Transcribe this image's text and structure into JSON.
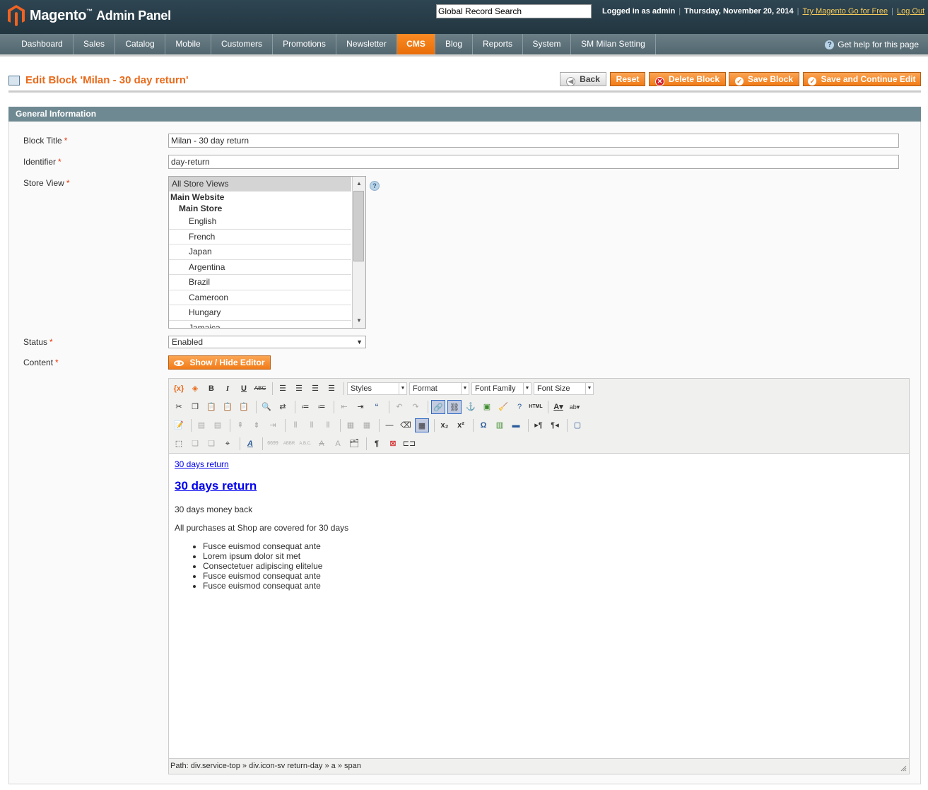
{
  "header": {
    "logo_brand": "Magento",
    "logo_sub": "Admin Panel",
    "search_placeholder": "Global Record Search",
    "logged_in": "Logged in as admin",
    "date": "Thursday, November 20, 2014",
    "try_link": "Try Magento Go for Free",
    "logout": "Log Out"
  },
  "nav": {
    "items": [
      "Dashboard",
      "Sales",
      "Catalog",
      "Mobile",
      "Customers",
      "Promotions",
      "Newsletter",
      "CMS",
      "Blog",
      "Reports",
      "System",
      "SM Milan Setting"
    ],
    "active": "CMS",
    "help": "Get help for this page"
  },
  "page": {
    "title": "Edit Block 'Milan - 30 day return'",
    "buttons": {
      "back": "Back",
      "reset": "Reset",
      "delete": "Delete Block",
      "save": "Save Block",
      "save_continue": "Save and Continue Edit"
    }
  },
  "form": {
    "section": "General Information",
    "block_title_label": "Block Title",
    "block_title_value": "Milan - 30 day return",
    "identifier_label": "Identifier",
    "identifier_value": "day-return",
    "store_view_label": "Store View",
    "store_view_selected": "All Store Views",
    "store_view_group": "Main Website",
    "store_view_subgroup": "Main Store",
    "store_views": [
      "English",
      "French",
      "Japan",
      "Argentina",
      "Brazil",
      "Cameroon",
      "Hungary",
      "Jamaica"
    ],
    "status_label": "Status",
    "status_value": "Enabled",
    "content_label": "Content",
    "toggle_editor": "Show / Hide Editor",
    "required_mark": "*"
  },
  "editor": {
    "styles": "Styles",
    "format": "Format",
    "font_family": "Font Family",
    "font_size": "Font Size",
    "content": {
      "link": "30 days return",
      "heading": "30 days return",
      "p1": "30 days money back",
      "p2": "All purchases at Shop are covered for 30 days",
      "bullets": [
        "Fusce euismod consequat ante",
        "Lorem ipsum dolor sit met",
        "Consectetuer adipiscing elitelue",
        "Fusce euismod consequat ante",
        "Fusce euismod consequat ante"
      ]
    },
    "path_label": "Path:",
    "path_items": [
      "div.service-top",
      "div.icon-sv return-day",
      "a",
      "span"
    ]
  }
}
